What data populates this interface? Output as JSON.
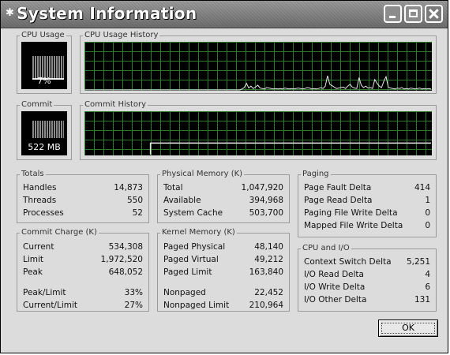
{
  "window": {
    "title": "System Information",
    "app_icon": "sysinfo-icon",
    "controls": {
      "minimize": "minimize-icon",
      "maximize": "maximize-icon",
      "close": "close-icon"
    }
  },
  "cpu": {
    "usage_label": "CPU Usage",
    "usage_value": "7%",
    "usage_fraction": 0.07,
    "history_label": "CPU Usage History",
    "history": [
      0,
      0,
      0,
      0,
      0,
      0,
      0,
      0,
      0,
      0,
      0,
      0,
      0,
      0,
      0,
      0,
      0,
      0,
      0,
      0,
      0,
      0,
      0,
      0,
      0,
      0,
      0,
      0,
      0,
      0,
      0,
      0,
      0,
      0,
      0,
      0,
      0,
      0,
      0,
      0,
      0,
      0,
      0,
      0,
      0,
      0,
      0,
      0,
      0,
      0,
      0,
      0,
      0,
      0,
      0,
      0,
      0,
      0,
      0,
      0,
      0,
      0,
      0,
      0,
      0,
      0,
      0,
      0,
      0,
      0,
      2,
      5,
      14,
      4,
      8,
      3,
      6,
      10,
      4,
      3,
      2,
      5,
      4,
      3,
      2,
      3,
      2,
      3,
      2,
      4,
      3,
      2,
      3,
      2,
      3,
      4,
      3,
      2,
      3,
      5,
      4,
      2,
      3,
      2,
      3,
      5,
      3,
      8,
      30,
      12,
      9,
      6,
      3,
      4,
      5,
      6,
      3,
      8,
      12,
      6,
      4,
      3,
      26,
      10,
      5,
      8,
      4,
      5,
      3,
      22,
      14,
      8,
      5,
      18,
      28,
      6,
      4,
      3,
      2,
      4,
      3,
      5,
      2,
      3,
      2,
      4,
      3,
      2,
      3,
      4,
      2,
      3,
      2,
      3,
      2
    ]
  },
  "commit": {
    "label": "Commit",
    "value": "522 MB",
    "history_label": "Commit History",
    "history_start_fraction": 0.19,
    "history_level": 0.27
  },
  "totals": {
    "title": "Totals",
    "rows": [
      {
        "label": "Handles",
        "value": "14,873"
      },
      {
        "label": "Threads",
        "value": "550"
      },
      {
        "label": "Processes",
        "value": "52"
      }
    ]
  },
  "commit_charge": {
    "title": "Commit Charge (K)",
    "rows": [
      {
        "label": "Current",
        "value": "534,308"
      },
      {
        "label": "Limit",
        "value": "1,972,520"
      },
      {
        "label": "Peak",
        "value": "648,052"
      }
    ],
    "rows2": [
      {
        "label": "Peak/Limit",
        "value": "33%"
      },
      {
        "label": "Current/Limit",
        "value": "27%"
      }
    ]
  },
  "physical_memory": {
    "title": "Physical Memory (K)",
    "rows": [
      {
        "label": "Total",
        "value": "1,047,920"
      },
      {
        "label": "Available",
        "value": "394,968"
      },
      {
        "label": "System Cache",
        "value": "503,700"
      }
    ]
  },
  "kernel_memory": {
    "title": "Kernel Memory (K)",
    "rows": [
      {
        "label": "Paged Physical",
        "value": "48,140"
      },
      {
        "label": "Paged Virtual",
        "value": "49,212"
      },
      {
        "label": "Paged Limit",
        "value": "163,840"
      }
    ],
    "rows2": [
      {
        "label": "Nonpaged",
        "value": "22,452"
      },
      {
        "label": "Nonpaged Limit",
        "value": "210,964"
      }
    ]
  },
  "paging": {
    "title": "Paging",
    "rows": [
      {
        "label": "Page Fault Delta",
        "value": "414"
      },
      {
        "label": "Page Read Delta",
        "value": "1"
      },
      {
        "label": "Paging File Write Delta",
        "value": "0"
      },
      {
        "label": "Mapped File Write Delta",
        "value": "0"
      }
    ]
  },
  "cpu_io": {
    "title": "CPU and I/O",
    "rows": [
      {
        "label": "Context Switch Delta",
        "value": "5,251"
      },
      {
        "label": "I/O Read Delta",
        "value": "4"
      },
      {
        "label": "I/O Write Delta",
        "value": "6"
      },
      {
        "label": "I/O Other Delta",
        "value": "131"
      }
    ]
  },
  "ok_button": "OK"
}
